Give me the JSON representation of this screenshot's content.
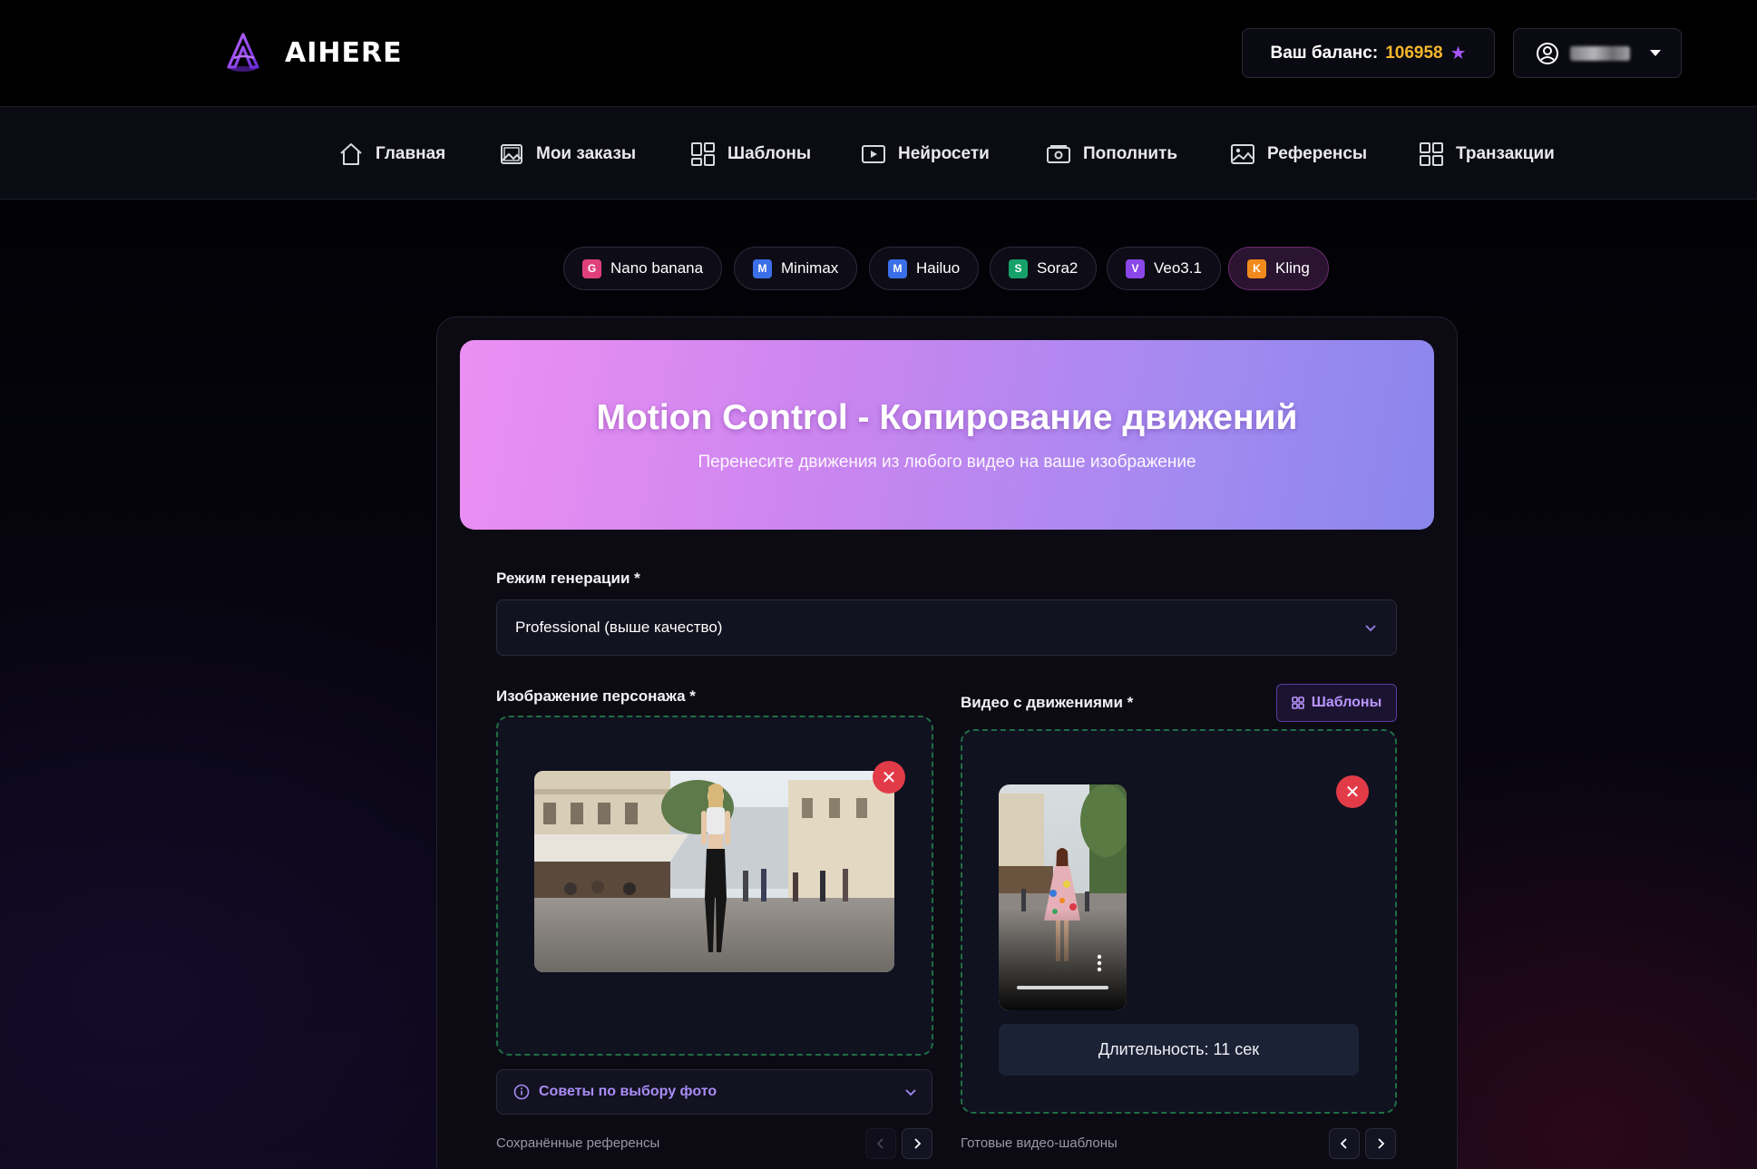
{
  "app": {
    "logo_text": "AIHERE",
    "brand_color": "#a855f7"
  },
  "header": {
    "balance_label": "Ваш баланс:",
    "balance_value": "106958",
    "balance_icon": "star-icon",
    "user_icon": "user-circle-icon"
  },
  "nav": {
    "items": [
      {
        "label": "Главная",
        "icon": "home-icon"
      },
      {
        "label": "Мои заказы",
        "icon": "image-icon"
      },
      {
        "label": "Шаблоны",
        "icon": "grid-icon"
      },
      {
        "label": "Нейросети",
        "icon": "play-icon"
      },
      {
        "label": "Пополнить",
        "icon": "wallet-icon"
      },
      {
        "label": "Референсы",
        "icon": "picture-icon"
      },
      {
        "label": "Транзакции",
        "icon": "grid-icon"
      }
    ]
  },
  "models": {
    "items": [
      {
        "badge": "G",
        "label": "Nano banana",
        "color": "#e0407a"
      },
      {
        "badge": "M",
        "label": "Minimax",
        "color": "#3b6fe8"
      },
      {
        "badge": "M",
        "label": "Hailuo",
        "color": "#3b6fe8"
      },
      {
        "badge": "S",
        "label": "Sora2",
        "color": "#16a06a"
      },
      {
        "badge": "V",
        "label": "Veo3.1",
        "color": "#8b46e8"
      },
      {
        "badge": "K",
        "label": "Kling",
        "color": "#f08a1c"
      }
    ],
    "active": "Kling"
  },
  "hero": {
    "title": "Motion Control - Копирование движений",
    "subtitle": "Перенесите движения из любого видео на ваше изображение"
  },
  "form": {
    "mode_label": "Режим генерации *",
    "mode_value": "Professional (выше качество)",
    "image_label": "Изображение персонажа *",
    "video_label": "Видео с движениями *",
    "templates_button": "Шаблоны",
    "duration_text": "Длительность: 11 сек",
    "tips_label": "Советы по выбору фото",
    "saved_refs_label": "Сохранённые референсы",
    "video_templates_label": "Готовые видео-шаблоны"
  },
  "colors": {
    "accent_purple": "#a98cf6",
    "remove_red": "#e23b48",
    "dashed_green": "#1f6e45",
    "balance_gold": "#f5b72a"
  }
}
